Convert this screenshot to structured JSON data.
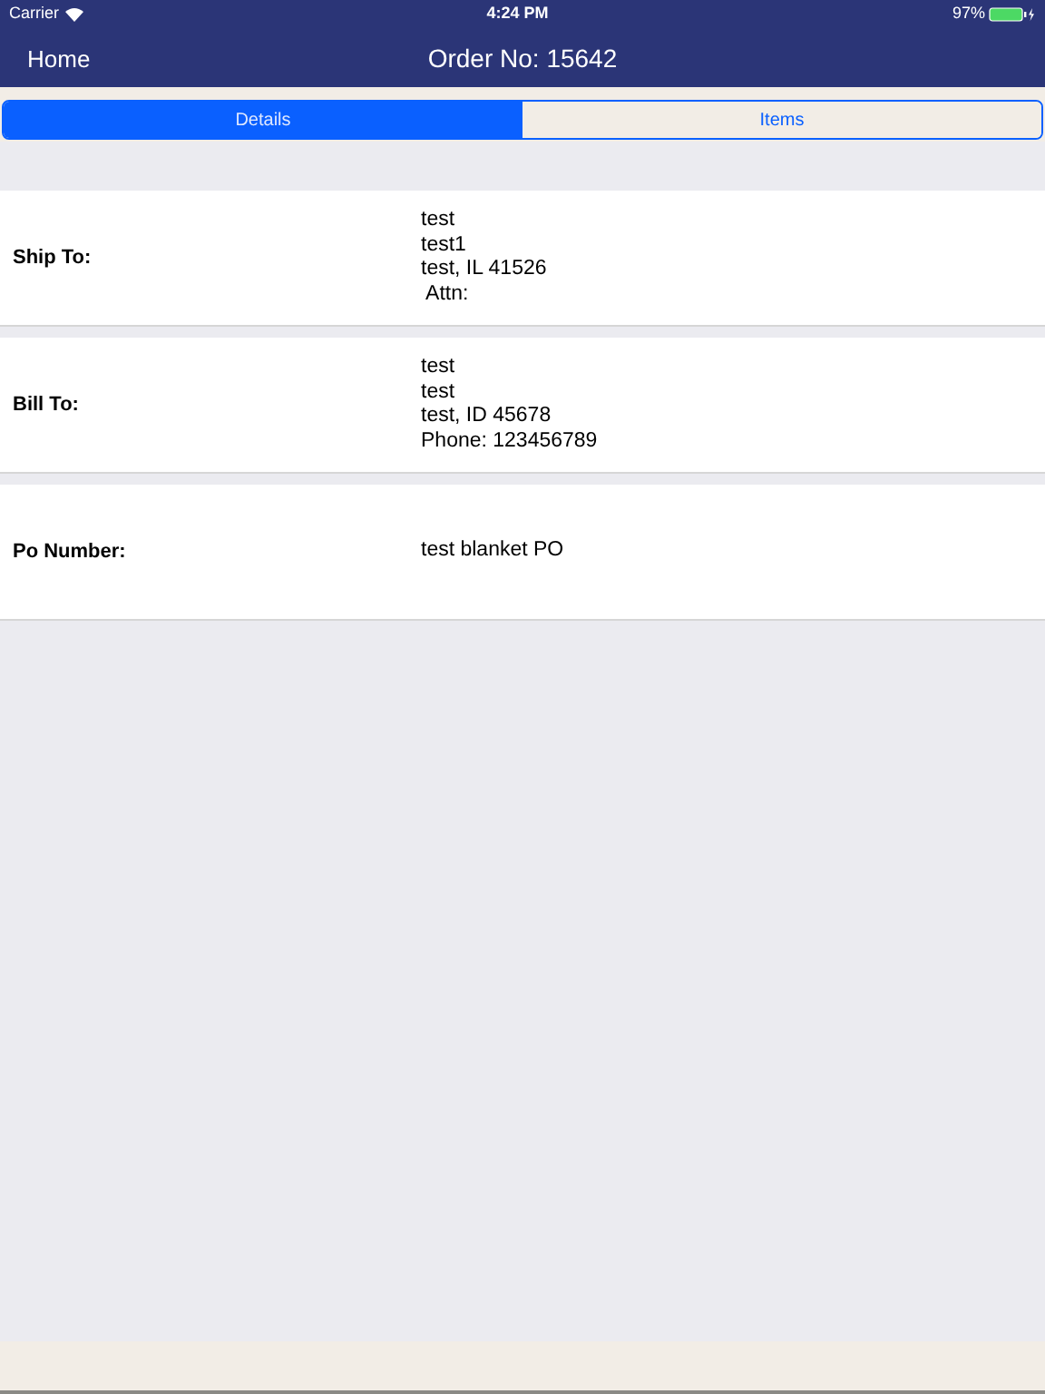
{
  "status_bar": {
    "carrier": "Carrier",
    "time": "4:24 PM",
    "battery": "97%"
  },
  "nav_bar": {
    "back": "Home",
    "title": "Order No: 15642"
  },
  "tabs": [
    {
      "label": "Details",
      "selected": true
    },
    {
      "label": "Items",
      "selected": false
    }
  ],
  "sections": [
    {
      "label": "Ship To:",
      "lines": [
        "test",
        "test1",
        "test, IL 41526",
        " Attn:"
      ]
    },
    {
      "label": "Bill To:",
      "lines": [
        "test",
        "test",
        "test, ID 45678",
        "Phone: 123456789"
      ]
    },
    {
      "label": "Po Number:",
      "lines": [
        "test blanket PO"
      ]
    }
  ]
}
